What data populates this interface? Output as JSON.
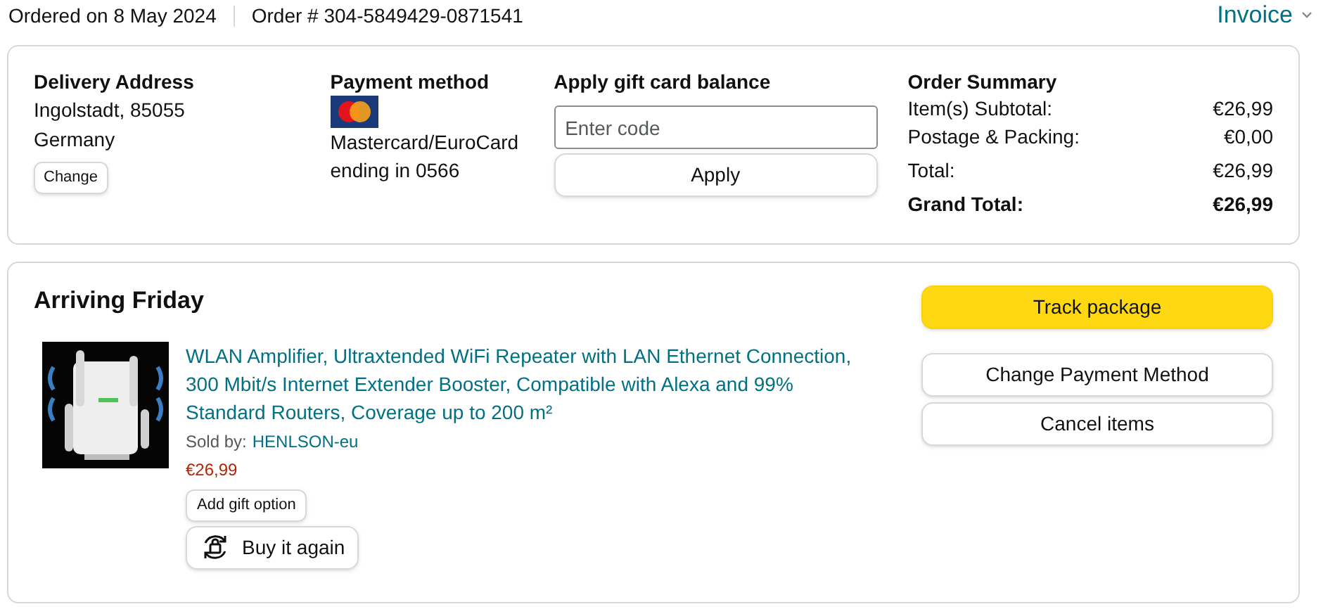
{
  "header": {
    "ordered": "Ordered on 8 May 2024",
    "order_number": "Order # 304-5849429-0871541",
    "invoice": "Invoice"
  },
  "delivery": {
    "title": "Delivery Address",
    "lines": [
      "Ingolstadt, 85055",
      "Germany"
    ],
    "button": "Change"
  },
  "payment": {
    "title": "Payment method",
    "lines": [
      "Mastercard/EuroCard",
      "ending in 0566"
    ]
  },
  "gift_card": {
    "title": "Apply gift card balance",
    "placeholder": "Enter code",
    "button": "Apply"
  },
  "summary": {
    "title": "Order Summary",
    "rows": [
      {
        "label": "Item(s) Subtotal:",
        "value": "€26,99",
        "kind": "line"
      },
      {
        "label": "Postage & Packing:",
        "value": "€0,00",
        "kind": "line"
      },
      {
        "label": "Total:",
        "value": "€26,99",
        "kind": "total"
      },
      {
        "label": "Grand Total:",
        "value": "€26,99",
        "kind": "grand"
      }
    ]
  },
  "shipment": {
    "status": "Arriving Friday",
    "item": {
      "title": "WLAN Amplifier, Ultraxtended WiFi Repeater with LAN Ethernet Connection, 300 Mbit/s Internet Extender Booster, Compatible with Alexa and 99% Standard Routers, Coverage up to 200 m²",
      "sold_by_label": "Sold by:",
      "seller": "HENLSON-eu",
      "price": "€26,99",
      "gift_button": "Add gift option",
      "buy_again": "Buy it again"
    },
    "actions": [
      {
        "label": "Track package",
        "kind": "primary"
      },
      {
        "label": "Change Payment Method",
        "kind": "secondary"
      },
      {
        "label": "Cancel items",
        "kind": "secondary"
      }
    ]
  }
}
